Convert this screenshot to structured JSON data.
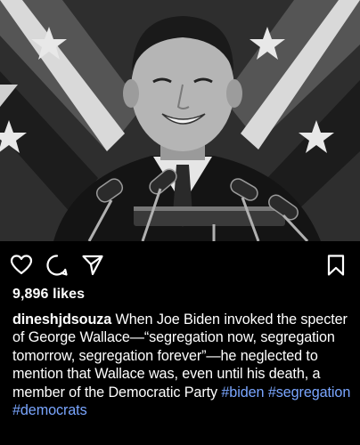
{
  "post": {
    "photo": {
      "description_icon": "portrait-photo",
      "tone": "black-and-white"
    },
    "actions": {
      "like_icon": "heart-icon",
      "comment_icon": "comment-icon",
      "share_icon": "share-icon",
      "save_icon": "bookmark-icon"
    },
    "likes_text": "9,896 likes",
    "caption": {
      "username": "dineshjdsouza",
      "text": " When Joe Biden invoked the specter of George Wallace—“segregation now, segregation tomorrow, segregation forever”—he neglected to mention that Wallace was, even until his death, a member of the Democratic Party ",
      "hashtags": [
        "#biden",
        "#segregation",
        "#democrats"
      ]
    },
    "colors": {
      "background": "#000000",
      "text": "#ffffff",
      "hashtag": "#7aa6ff"
    }
  }
}
